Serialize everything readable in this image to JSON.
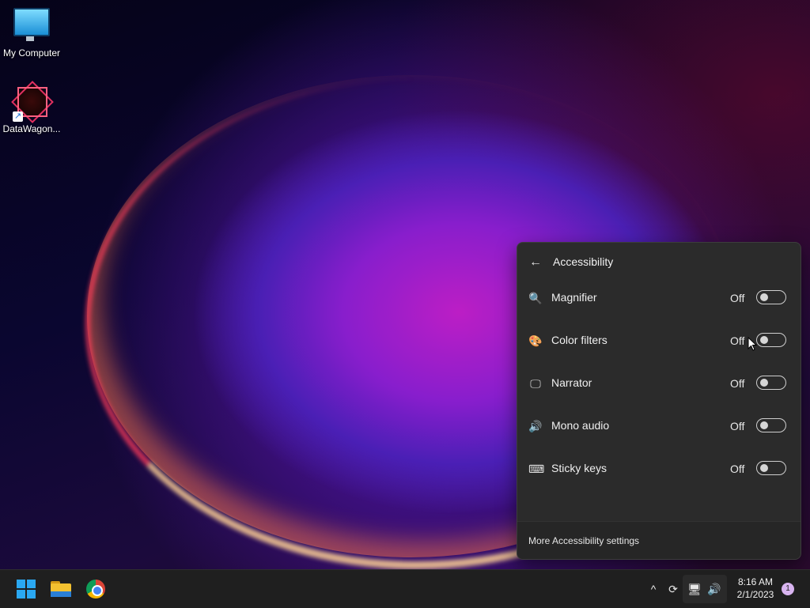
{
  "desktop": {
    "icons": [
      {
        "label": "My Computer",
        "icon": "monitor-icon"
      },
      {
        "label": "DataWagon...",
        "icon": "datawagon-logo-icon"
      }
    ]
  },
  "accessibility_panel": {
    "back_icon": "←",
    "title": "Accessibility",
    "rows": [
      {
        "label": "Magnifier",
        "icon": "🔍",
        "state": "Off",
        "toggle_on": false
      },
      {
        "label": "Color filters",
        "icon": "🎨",
        "state": "Off",
        "toggle_on": false
      },
      {
        "label": "Narrator",
        "icon": "🖵",
        "state": "Off",
        "toggle_on": false
      },
      {
        "label": "Mono audio",
        "icon": "🔊",
        "state": "Off",
        "toggle_on": false
      },
      {
        "label": "Sticky keys",
        "icon": "⌨",
        "state": "Off",
        "toggle_on": false
      }
    ],
    "footer_link": "More Accessibility settings"
  },
  "taskbar": {
    "pinned": [
      "start-button",
      "file-explorer",
      "chrome"
    ],
    "tray": {
      "chevron": "^",
      "sync_icon": "⟳",
      "network_icon": "🖥",
      "volume_icon": "🔊"
    },
    "clock": {
      "time": "8:16 AM",
      "date": "2/1/2023"
    },
    "notification_count": "1"
  }
}
